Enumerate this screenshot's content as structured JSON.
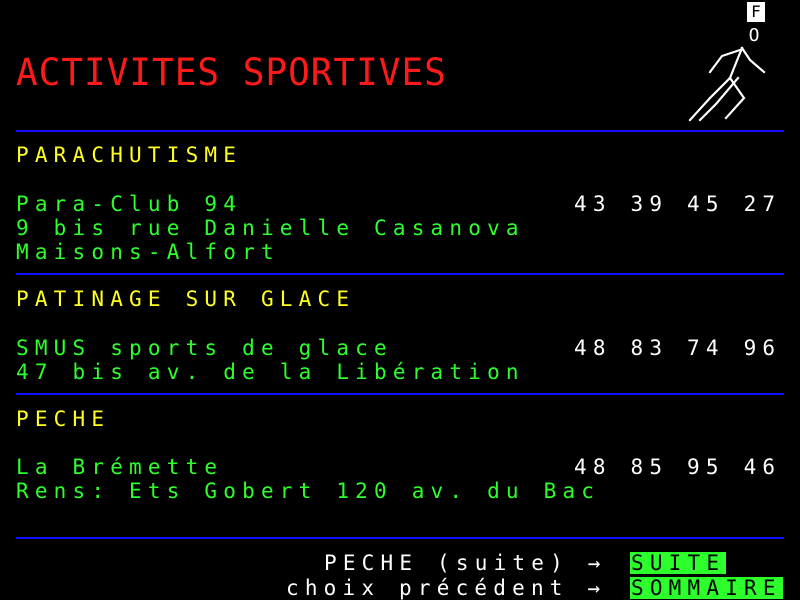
{
  "page": {
    "title": "ACTIVITES SPORTIVES",
    "corner_letters": [
      "F",
      "O"
    ],
    "logo_icon": "running-man-icon",
    "colors": {
      "background": "#000000",
      "title": "#ff1a1a",
      "category": "#ffff20",
      "entry": "#2cff2c",
      "phone": "#ffffff",
      "separator": "#1010ff",
      "key_bg": "#2cff2c"
    }
  },
  "sections": [
    {
      "category": "PARACHUTISME",
      "lines": [
        "Para-Club 94",
        "9 bis rue Danielle Casanova",
        "Maisons-Alfort"
      ],
      "phone": "43 39 45 27"
    },
    {
      "category": "PATINAGE SUR GLACE",
      "lines": [
        "SMUS sports de glace",
        "47 bis av. de la Libération"
      ],
      "phone": "48 83 74 96"
    },
    {
      "category": "PECHE",
      "lines": [
        "La Brémette",
        "Rens: Ets Gobert 120 av. du Bac"
      ],
      "phone": "48 85 95 46"
    }
  ],
  "nav": {
    "next_text": "PECHE (suite) →",
    "next_key": "SUITE",
    "back_text": "choix précédent →",
    "back_key": "SOMMAIRE"
  }
}
